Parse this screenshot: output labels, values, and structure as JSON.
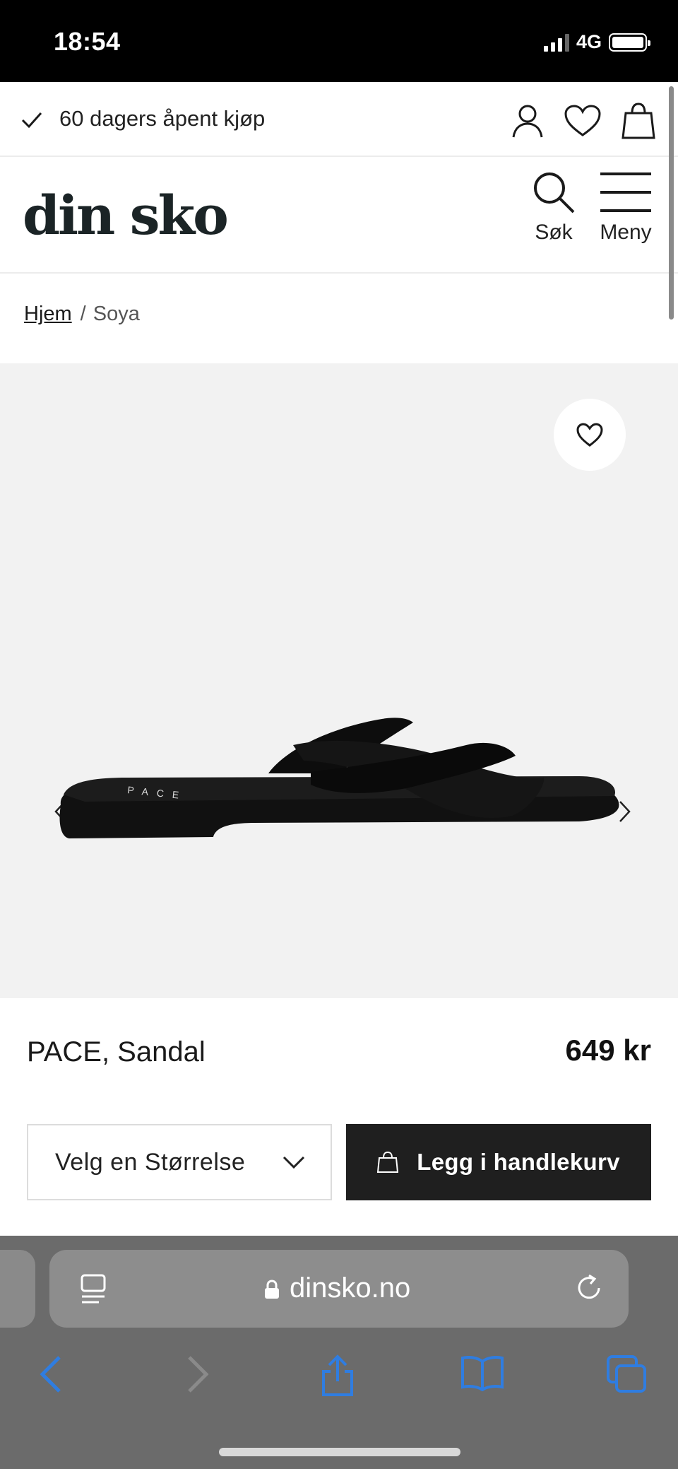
{
  "status_bar": {
    "time": "18:54",
    "network": "4G"
  },
  "promo": {
    "text": "60 dagers åpent kjøp"
  },
  "header": {
    "logo": "din sko",
    "search_label": "Søk",
    "menu_label": "Meny"
  },
  "breadcrumb": {
    "home": "Hjem",
    "separator": "/",
    "current": "Soya"
  },
  "product": {
    "name": "PACE, Sandal",
    "price": "649 kr",
    "shoe_brand_print": "PACE"
  },
  "purchase": {
    "size_select_label": "Velg en Størrelse",
    "add_to_cart_label": "Legg i handlekurv"
  },
  "browser": {
    "url": "dinsko.no"
  },
  "colors": {
    "status_bar": "#000000",
    "logo": "#1b2426",
    "gallery_bg": "#f2f2f2",
    "cart_button": "#1f1f1f",
    "browser_chrome": "#6b6b6b",
    "toolbar_accent": "#2f7de1"
  },
  "icons": {
    "promo": "check-icon",
    "account": "user-icon",
    "wishlist": "heart-icon",
    "cart": "bag-icon",
    "search": "search-icon",
    "menu": "hamburger-icon"
  }
}
